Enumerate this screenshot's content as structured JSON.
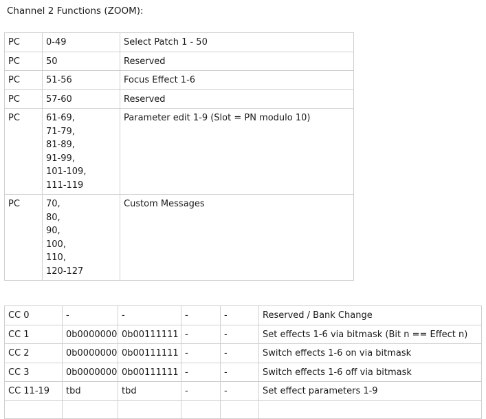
{
  "title": "Channel 2 Functions (ZOOM):",
  "pc_table": [
    {
      "type": "PC",
      "range": [
        "0-49"
      ],
      "desc": "Select Patch 1 - 50"
    },
    {
      "type": "PC",
      "range": [
        "50"
      ],
      "desc": "Reserved"
    },
    {
      "type": "PC",
      "range": [
        "51-56"
      ],
      "desc": "Focus Effect 1-6"
    },
    {
      "type": "PC",
      "range": [
        "57-60"
      ],
      "desc": "Reserved"
    },
    {
      "type": "PC",
      "range": [
        "61-69,",
        "71-79,",
        "81-89,",
        "91-99,",
        "101-109,",
        "111-119"
      ],
      "desc": "Parameter edit 1-9 (Slot = PN modulo 10)"
    },
    {
      "type": "PC",
      "range": [
        "70,",
        "80,",
        "90,",
        "100,",
        "110,",
        "120-127"
      ],
      "desc": "Custom Messages"
    }
  ],
  "cc_table": [
    {
      "cc": "CC 0",
      "min": "-",
      "max": "-",
      "c4": "-",
      "c5": "-",
      "desc": "Reserved / Bank Change"
    },
    {
      "cc": "CC 1",
      "min": "0b0000000",
      "max": "0b00111111",
      "c4": "-",
      "c5": "-",
      "desc": "Set effects 1-6 via bitmask (Bit n == Effect n)"
    },
    {
      "cc": "CC 2",
      "min": "0b0000000",
      "max": "0b00111111",
      "c4": "-",
      "c5": "-",
      "desc": "Switch effects 1-6 on via bitmask"
    },
    {
      "cc": "CC 3",
      "min": "0b0000000",
      "max": "0b00111111",
      "c4": "-",
      "c5": "-",
      "desc": "Switch effects 1-6 off via bitmask"
    },
    {
      "cc": "CC 11-19",
      "min": "tbd",
      "max": "tbd",
      "c4": "-",
      "c5": "-",
      "desc": "Set effect parameters 1-9"
    },
    {
      "cc": "",
      "min": "",
      "max": "",
      "c4": "",
      "c5": "",
      "desc": ""
    }
  ]
}
